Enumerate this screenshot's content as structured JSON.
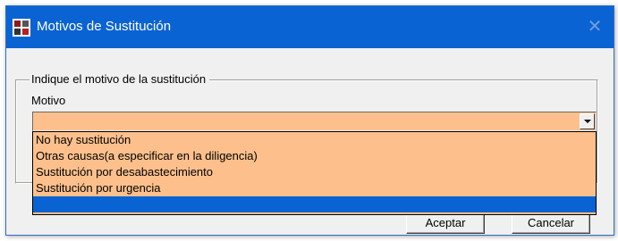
{
  "window": {
    "title": "Motivos de Sustitución",
    "app_icon": "app-icon",
    "close_icon": "close-icon"
  },
  "group": {
    "legend": "Indique el motivo de la sustitución"
  },
  "motivo": {
    "label": "Motivo",
    "value": "",
    "arrow_icon": "chevron-down-icon"
  },
  "dropdown": {
    "options": [
      "No hay sustitución",
      "Otras causas(a especificar en la diligencia)",
      "Sustitución por desabastecimiento",
      "Sustitución por urgencia",
      ""
    ],
    "selected_index": 4
  },
  "buttons": {
    "accept": "Aceptar",
    "cancel": "Cancelar"
  },
  "colors": {
    "titlebar": "#0a63d2",
    "field_background": "#fdc08c",
    "selection": "#0a63d2"
  }
}
